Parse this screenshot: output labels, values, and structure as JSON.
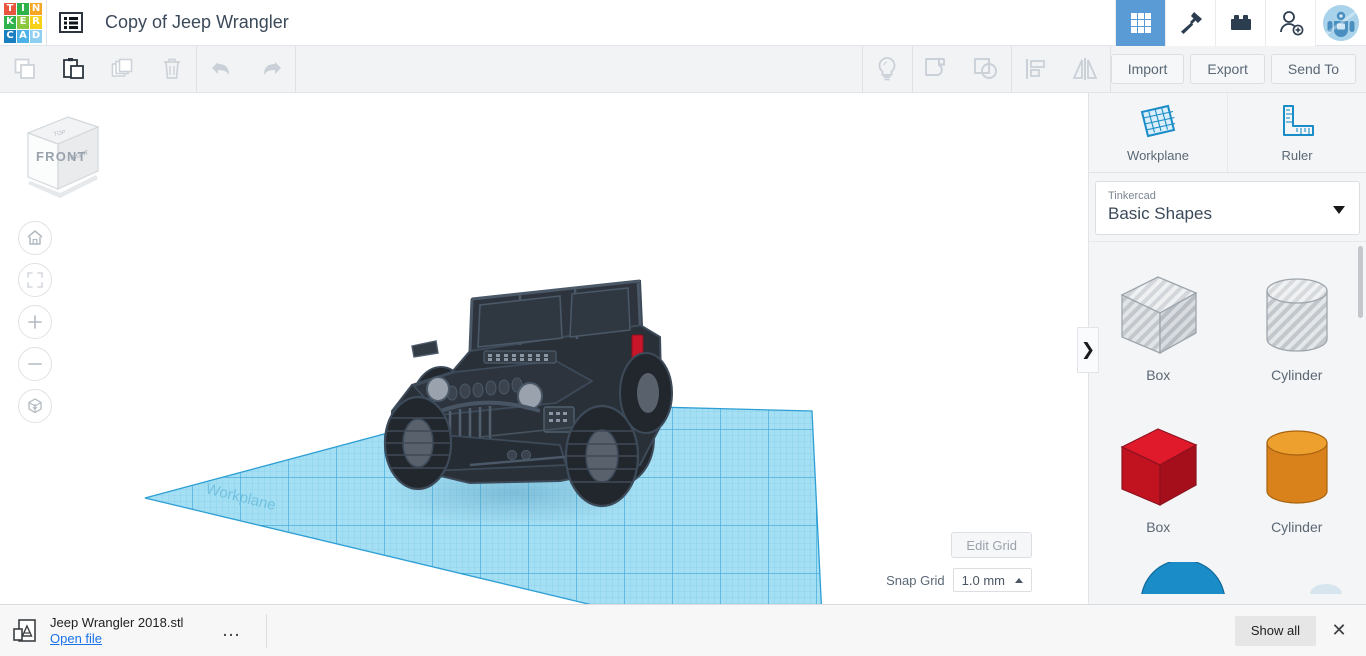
{
  "header": {
    "logo_letters": [
      "T",
      "I",
      "N",
      "K",
      "E",
      "R",
      "C",
      "A",
      "D"
    ],
    "logo_colors": [
      "#e8563f",
      "#2fb14c",
      "#f5a623",
      "#2fb14c",
      "#8bc63f",
      "#f7d117",
      "#1a7fc1",
      "#4db2e8",
      "#8fd0f0"
    ],
    "doc_icon": "list-icon",
    "title": "Copy of Jeep Wrangler",
    "nav_icons": [
      {
        "name": "grid-icon",
        "active": true
      },
      {
        "name": "hammer-icon",
        "active": false
      },
      {
        "name": "brick-icon",
        "active": false
      },
      {
        "name": "add-user-icon",
        "active": false
      }
    ],
    "avatar_name": "user-avatar"
  },
  "toolbar": {
    "left_icons": [
      {
        "name": "copy-icon",
        "enabled": false
      },
      {
        "name": "paste-icon",
        "enabled": true
      },
      {
        "name": "duplicate-icon",
        "enabled": false
      },
      {
        "name": "delete-icon",
        "enabled": false
      }
    ],
    "history_icons": [
      {
        "name": "undo-icon",
        "enabled": false
      },
      {
        "name": "redo-icon",
        "enabled": false
      }
    ],
    "mid_icons": [
      {
        "name": "lightbulb-icon",
        "enabled": false
      },
      {
        "name": "group-icon",
        "enabled": false
      },
      {
        "name": "ungroup-icon",
        "enabled": false
      }
    ],
    "align_icons": [
      {
        "name": "align-icon",
        "enabled": false
      },
      {
        "name": "mirror-icon",
        "enabled": false
      }
    ],
    "actions": [
      {
        "name": "import-button",
        "label": "Import"
      },
      {
        "name": "export-button",
        "label": "Export"
      },
      {
        "name": "send-to-button",
        "label": "Send To"
      }
    ]
  },
  "canvas": {
    "viewcube_face": "FRONT",
    "workplane_label": "Workplane",
    "nav_buttons": [
      {
        "name": "home-view-button",
        "icon": "home-icon"
      },
      {
        "name": "fit-view-button",
        "icon": "fit-frame-icon"
      },
      {
        "name": "zoom-in-button",
        "icon": "plus-icon"
      },
      {
        "name": "zoom-out-button",
        "icon": "minus-icon"
      },
      {
        "name": "perspective-toggle-button",
        "icon": "cube-perspective-icon"
      }
    ],
    "edit_grid_label": "Edit Grid",
    "snap_grid_label": "Snap Grid",
    "snap_grid_value": "1.0 mm",
    "collapse_handle": "❯",
    "model": {
      "name": "jeep-wrangler-model",
      "body_color": "#2a3038",
      "accent_color": "#c8152a",
      "grid_color": "#9ddcf2",
      "grid_line_color": "#2e9fd4"
    }
  },
  "right_panel": {
    "tools": [
      {
        "name": "workplane-tool",
        "label": "Workplane",
        "icon": "workplane-icon"
      },
      {
        "name": "ruler-tool",
        "label": "Ruler",
        "icon": "ruler-icon"
      }
    ],
    "library": {
      "owner": "Tinkercad",
      "collection": "Basic Shapes"
    },
    "shapes": [
      {
        "name": "shape-box-hole",
        "label": "Box",
        "style": "hole"
      },
      {
        "name": "shape-cylinder-hole",
        "label": "Cylinder",
        "style": "hole"
      },
      {
        "name": "shape-box-red",
        "label": "Box",
        "style": "solid",
        "color": "#cc1b2b"
      },
      {
        "name": "shape-cylinder-orange",
        "label": "Cylinder",
        "style": "solid",
        "color": "#e88b1e"
      }
    ]
  },
  "bottom_bar": {
    "file_icon": "file-download-icon",
    "file_name": "Jeep Wrangler 2018.stl",
    "open_file_label": "Open file",
    "more_label": "…",
    "show_all_label": "Show all",
    "close_label": "✕"
  }
}
